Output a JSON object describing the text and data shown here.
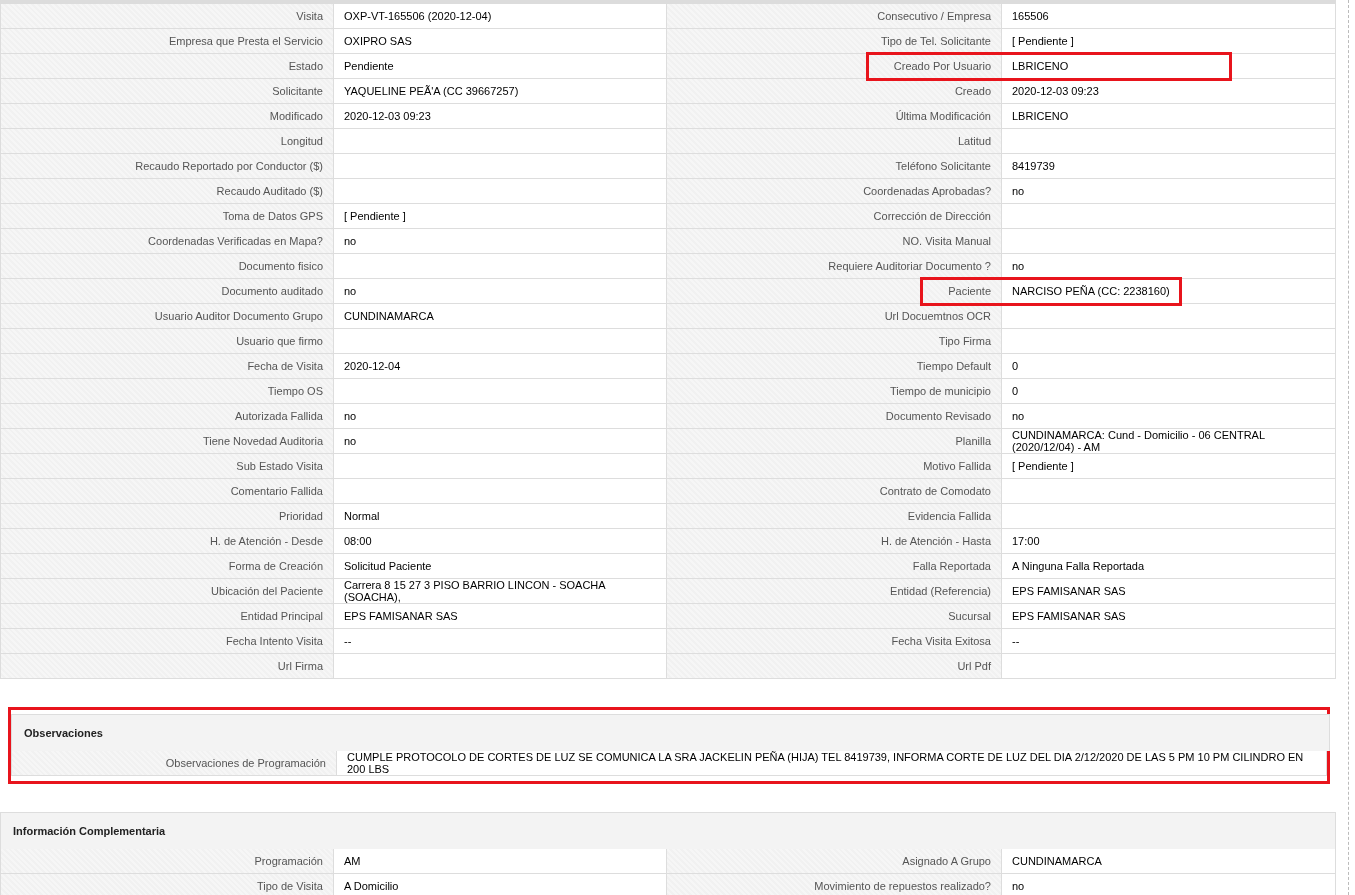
{
  "details": {
    "rows": [
      {
        "cells": [
          {
            "label": "Visita",
            "value": "OXP-VT-165506 (2020-12-04)",
            "highlighted": false
          },
          {
            "label": "Consecutivo / Empresa",
            "value": "165506",
            "highlighted": false
          }
        ]
      },
      {
        "cells": [
          {
            "label": "Empresa que Presta el Servicio",
            "value": "OXIPRO SAS",
            "highlighted": false
          },
          {
            "label": "Tipo de Tel. Solicitante",
            "value": "[ Pendiente ]",
            "highlighted": false
          }
        ]
      },
      {
        "cells": [
          {
            "label": "Estado",
            "value": "Pendiente",
            "highlighted": false
          },
          {
            "label": "Creado Por Usuario",
            "value": "LBRICENO",
            "highlighted": true
          }
        ]
      },
      {
        "cells": [
          {
            "label": "Solicitante",
            "value": "YAQUELINE PEÃ'A (CC 39667257)",
            "highlighted": false
          },
          {
            "label": "Creado",
            "value": "2020-12-03 09:23",
            "highlighted": false
          }
        ]
      },
      {
        "cells": [
          {
            "label": "Modificado",
            "value": "2020-12-03 09:23",
            "highlighted": false
          },
          {
            "label": "Última Modificación",
            "value": "LBRICENO",
            "highlighted": false
          }
        ]
      },
      {
        "cells": [
          {
            "label": "Longitud",
            "highlighted": false
          },
          {
            "label": "Latitud",
            "highlighted": false
          }
        ]
      },
      {
        "cells": [
          {
            "label": "Recaudo Reportado por Conductor ($)",
            "highlighted": false
          },
          {
            "label": "Teléfono Solicitante",
            "value": "8419739",
            "highlighted": false
          }
        ]
      },
      {
        "cells": [
          {
            "label": "Recaudo Auditado ($)",
            "highlighted": false
          },
          {
            "label": "Coordenadas Aprobadas?",
            "value": "no",
            "highlighted": false
          }
        ]
      },
      {
        "cells": [
          {
            "label": "Toma de Datos GPS",
            "value": "[ Pendiente ]",
            "highlighted": false
          },
          {
            "label": "Corrección de Dirección",
            "highlighted": false
          }
        ]
      },
      {
        "cells": [
          {
            "label": "Coordenadas Verificadas en Mapa?",
            "value": "no",
            "highlighted": false
          },
          {
            "label": "NO. Visita Manual",
            "highlighted": false
          }
        ]
      },
      {
        "cells": [
          {
            "label": "Documento fisico",
            "highlighted": false
          },
          {
            "label": "Requiere Auditoriar Documento ?",
            "value": "no",
            "highlighted": false
          }
        ]
      },
      {
        "cells": [
          {
            "label": "Documento auditado",
            "value": "no",
            "highlighted": false
          },
          {
            "label": "Paciente",
            "value": "NARCISO PEÑA (CC: 2238160)",
            "highlighted": true
          }
        ]
      },
      {
        "cells": [
          {
            "label": "Usuario Auditor Documento Grupo",
            "value": "CUNDINAMARCA",
            "highlighted": false
          },
          {
            "label": "Url Docuemtnos OCR",
            "highlighted": false
          }
        ]
      },
      {
        "cells": [
          {
            "label": "Usuario que firmo",
            "highlighted": false
          },
          {
            "label": "Tipo Firma",
            "highlighted": false
          }
        ]
      },
      {
        "cells": [
          {
            "label": "Fecha de Visita",
            "value": "2020-12-04",
            "highlighted": false
          },
          {
            "label": "Tiempo Default",
            "value": "0",
            "highlighted": false
          }
        ]
      },
      {
        "cells": [
          {
            "label": "Tiempo OS",
            "highlighted": false
          },
          {
            "label": "Tiempo de municipio",
            "value": "0",
            "highlighted": false
          }
        ]
      },
      {
        "cells": [
          {
            "label": "Autorizada Fallida",
            "value": "no",
            "highlighted": false
          },
          {
            "label": "Documento Revisado",
            "value": "no",
            "highlighted": false
          }
        ]
      },
      {
        "cells": [
          {
            "label": "Tiene Novedad Auditoria",
            "value": "no",
            "highlighted": false
          },
          {
            "label": "Planilla",
            "value": "CUNDINAMARCA: Cund - Domicilio - 06 CENTRAL (2020/12/04) - AM",
            "highlighted": false
          }
        ]
      },
      {
        "cells": [
          {
            "label": "Sub Estado Visita",
            "highlighted": false
          },
          {
            "label": "Motivo Fallida",
            "value": "[ Pendiente ]",
            "highlighted": false
          }
        ]
      },
      {
        "cells": [
          {
            "label": "Comentario Fallida",
            "highlighted": false
          },
          {
            "label": "Contrato de Comodato",
            "highlighted": false
          }
        ]
      },
      {
        "cells": [
          {
            "label": "Prioridad",
            "value": "Normal",
            "highlighted": false
          },
          {
            "label": "Evidencia Fallida",
            "highlighted": false
          }
        ]
      },
      {
        "cells": [
          {
            "label": "H. de Atención - Desde",
            "value": "08:00",
            "highlighted": false
          },
          {
            "label": "H. de Atención - Hasta",
            "value": "17:00",
            "highlighted": false
          }
        ]
      },
      {
        "cells": [
          {
            "label": "Forma de Creación",
            "value": "Solicitud Paciente",
            "highlighted": false
          },
          {
            "label": "Falla Reportada",
            "value": "A Ninguna Falla Reportada",
            "highlighted": false
          }
        ]
      },
      {
        "cells": [
          {
            "label": "Ubicación del Paciente",
            "value": "Carrera 8 15 27 3 PISO BARRIO LINCON - SOACHA (SOACHA),",
            "highlighted": false
          },
          {
            "label": "Entidad (Referencia)",
            "value": "EPS FAMISANAR SAS",
            "highlighted": false
          }
        ]
      },
      {
        "cells": [
          {
            "label": "Entidad Principal",
            "value": "EPS FAMISANAR SAS",
            "highlighted": false
          },
          {
            "label": "Sucursal",
            "value": "EPS FAMISANAR SAS",
            "highlighted": false
          }
        ]
      },
      {
        "cells": [
          {
            "label": "Fecha Intento Visita",
            "value": "--",
            "highlighted": false
          },
          {
            "label": "Fecha Visita Exitosa",
            "value": "--",
            "highlighted": false
          }
        ]
      },
      {
        "cells": [
          {
            "label": "Url Firma",
            "highlighted": false
          },
          {
            "label": "Url Pdf",
            "highlighted": false
          }
        ]
      }
    ]
  },
  "sections": [
    {
      "title": "Observaciones",
      "highlighted": true,
      "rows": [
        {
          "cells": [
            {
              "label": "Observaciones de Programación",
              "value": "CUMPLE PROTOCOLO DE CORTES DE LUZ SE COMUNICA LA SRA JACKELIN PEÑA (HIJA) TEL 8419739, INFORMA CORTE DE LUZ DEL DIA 2/12/2020 DE LAS 5 PM 10 PM CILINDRO EN 200 LBS",
              "highlighted": false
            }
          ]
        }
      ]
    },
    {
      "title": "Información Complementaria",
      "highlighted": false,
      "rows": [
        {
          "cells": [
            {
              "label": "Programación",
              "value": "AM",
              "highlighted": false
            },
            {
              "label": "Asignado A Grupo",
              "value": "CUNDINAMARCA",
              "highlighted": false
            }
          ]
        },
        {
          "cells": [
            {
              "label": "Tipo de Visita",
              "value": "A Domicilio",
              "highlighted": false
            },
            {
              "label": "Movimiento de repuestos realizado?",
              "value": "no",
              "highlighted": false
            }
          ]
        }
      ]
    }
  ]
}
